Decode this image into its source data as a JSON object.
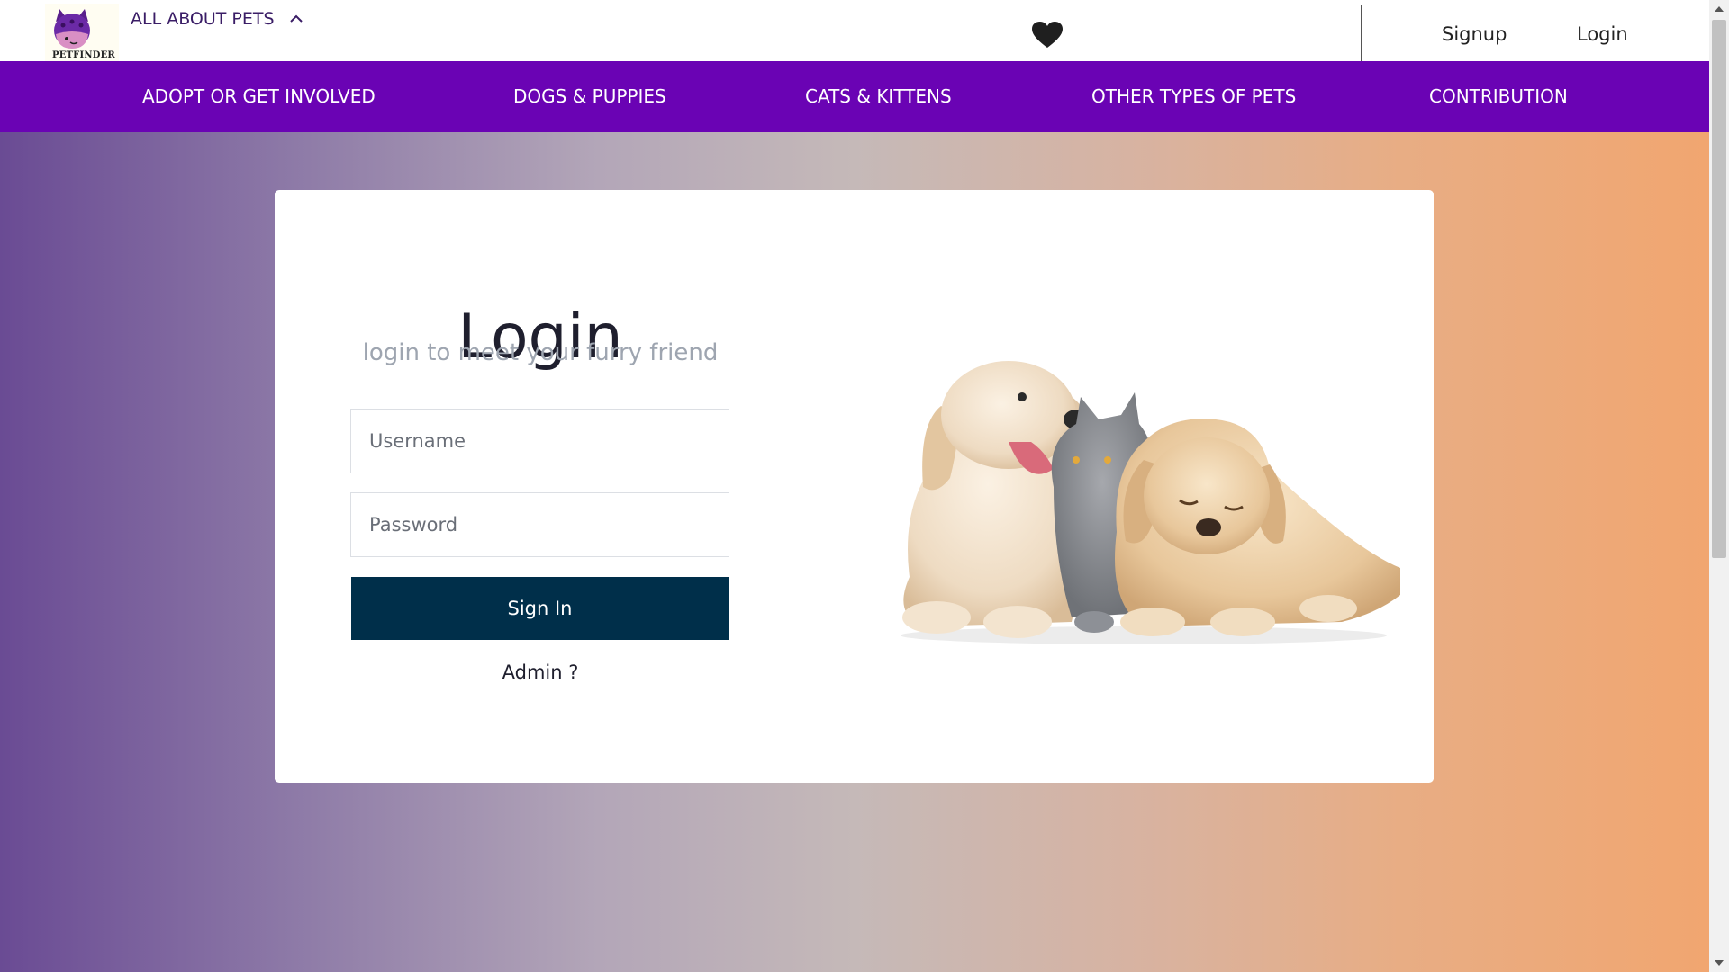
{
  "header": {
    "logo_text": "PETFINDER",
    "about_menu_label": "ALL ABOUT PETS",
    "about_menu_icon": "chevron-up-icon",
    "favorites_icon": "heart-icon",
    "signup_label": "Signup",
    "login_label": "Login"
  },
  "nav": {
    "items": [
      {
        "label": "ADOPT OR GET INVOLVED"
      },
      {
        "label": "DOGS & PUPPIES"
      },
      {
        "label": "CATS & KITTENS"
      },
      {
        "label": "OTHER TYPES OF PETS"
      },
      {
        "label": "CONTRIBUTION"
      }
    ]
  },
  "login_form": {
    "title": "Login",
    "subtitle": "login to meet your furry friend",
    "username_placeholder": "Username",
    "username_value": "",
    "password_placeholder": "Password",
    "password_value": "",
    "signin_label": "Sign In",
    "admin_label": "Admin ?"
  },
  "colors": {
    "nav_background": "#6a03b4",
    "signin_button": "#002f4a",
    "background_gradient_start": "#6a4b94",
    "background_gradient_end": "#f1a670"
  }
}
